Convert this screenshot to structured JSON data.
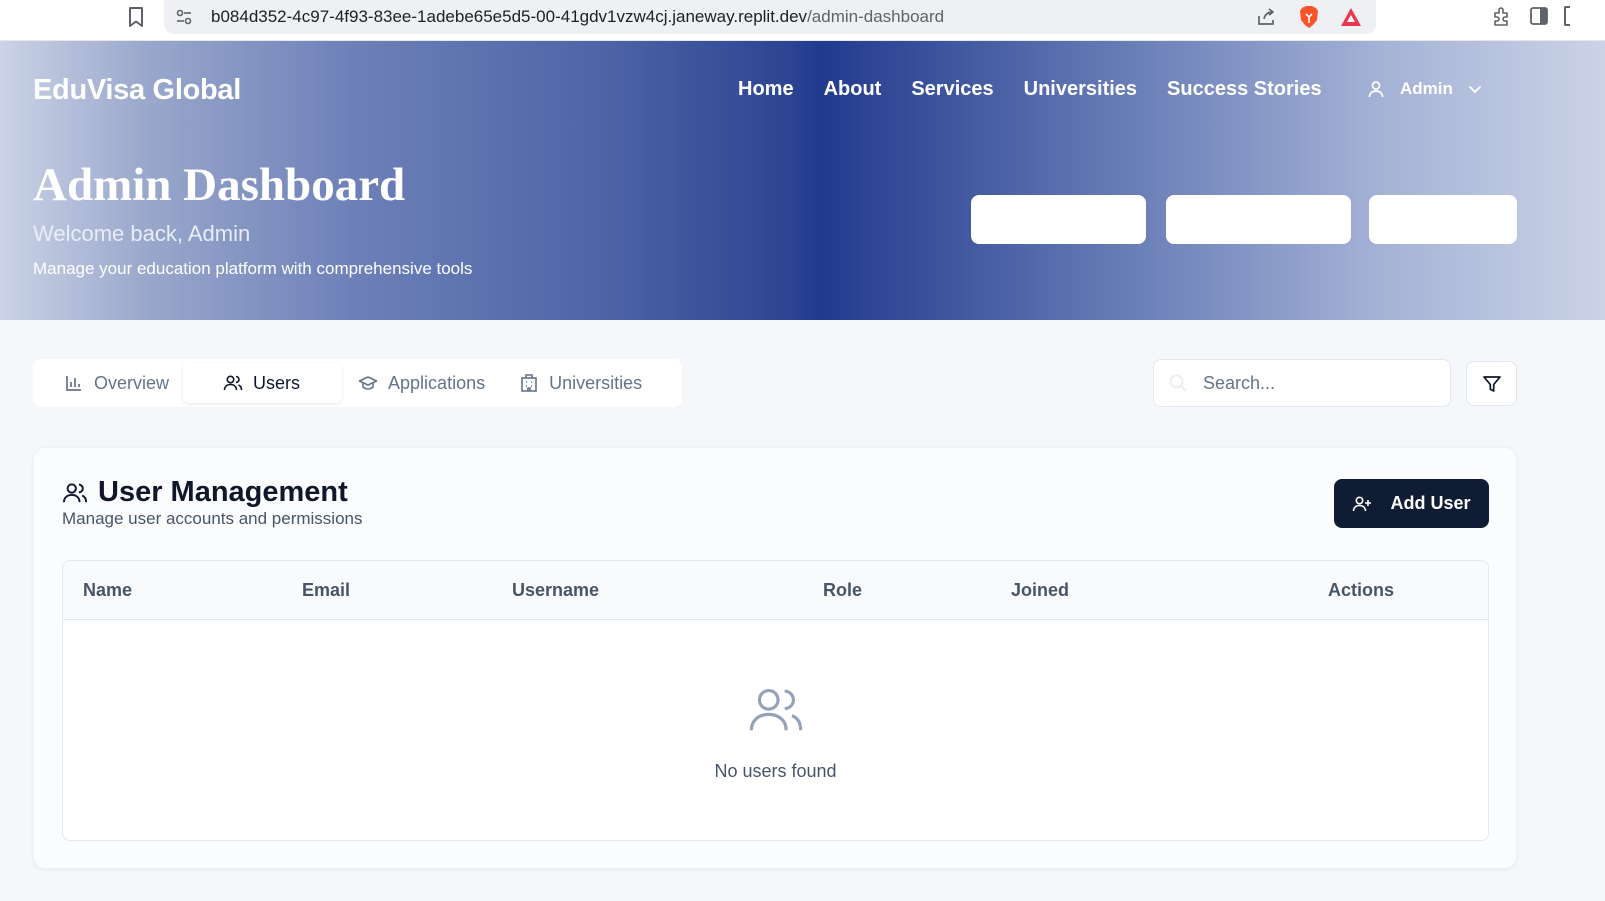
{
  "browser": {
    "url_host": "b084d352-4c97-4f93-83ee-1adebe65e5d5-00-41gdv1vzw4cj.janeway.replit.dev",
    "url_path": "/admin-dashboard"
  },
  "header": {
    "brand": "EduVisa Global",
    "nav": [
      "Home",
      "About",
      "Services",
      "Universities",
      "Success Stories"
    ],
    "user_label": "Admin"
  },
  "hero": {
    "title": "Admin Dashboard",
    "welcome": "Welcome back, Admin",
    "tagline": "Manage your education platform with comprehensive tools"
  },
  "tabs": [
    {
      "label": "Overview",
      "icon": "bar-chart-icon"
    },
    {
      "label": "Users",
      "icon": "users-icon",
      "active": true
    },
    {
      "label": "Applications",
      "icon": "graduation-cap-icon"
    },
    {
      "label": "Universities",
      "icon": "building-icon"
    }
  ],
  "search": {
    "placeholder": "Search..."
  },
  "card": {
    "title": "User Management",
    "subtitle": "Manage user accounts and permissions",
    "add_button": "Add User"
  },
  "table": {
    "columns": [
      "Name",
      "Email",
      "Username",
      "Role",
      "Joined",
      "Actions"
    ],
    "rows": [],
    "empty_text": "No users found"
  },
  "colors": {
    "accent_dark": "#0f1c33",
    "hero_blue": "#223a8d"
  }
}
